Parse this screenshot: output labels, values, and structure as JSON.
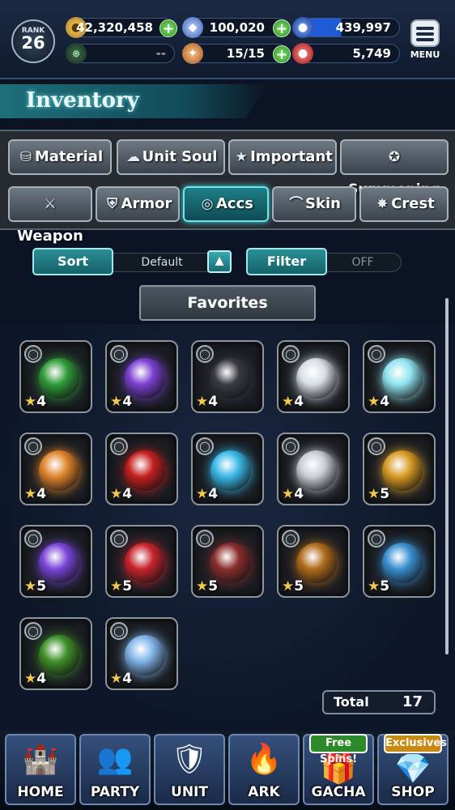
{
  "header": {
    "rank_label": "RANK",
    "rank_value": "26",
    "gold": "42,320,458",
    "crystals": "100,020",
    "blue_currency": "439,997",
    "guild_status": "--",
    "stamina": "15/15",
    "red_currency": "5,749",
    "menu_label": "MENU"
  },
  "title": "Inventory",
  "tabs_row1": [
    {
      "label": "Material",
      "icon": "sack-icon"
    },
    {
      "label": "Unit Soul",
      "icon": "soul-flame-icon"
    },
    {
      "label": "Important",
      "icon": "star-icon"
    },
    {
      "label": "Summoning",
      "icon": "summon-crest-icon"
    }
  ],
  "tabs_row2": [
    {
      "label": "Weapon",
      "icon": "sword-icon"
    },
    {
      "label": "Armor",
      "icon": "armor-icon"
    },
    {
      "label": "Accs",
      "icon": "necklace-icon"
    },
    {
      "label": "Skin",
      "icon": "hanger-icon"
    },
    {
      "label": "Crest",
      "icon": "crest-icon"
    }
  ],
  "active_tab": "Accs",
  "sort": {
    "label": "Sort",
    "value": "Default"
  },
  "filter": {
    "label": "Filter",
    "value": "OFF"
  },
  "favorites_label": "Favorites",
  "items": [
    {
      "rarity": "4",
      "color": "#2f9a3a"
    },
    {
      "rarity": "4",
      "color": "#7b3fd1"
    },
    {
      "rarity": "4",
      "color": "#3a3a46"
    },
    {
      "rarity": "4",
      "color": "#d8dde6"
    },
    {
      "rarity": "4",
      "color": "#8fe3ef"
    },
    {
      "rarity": "4",
      "color": "#e0842a"
    },
    {
      "rarity": "4",
      "color": "#c51f1f"
    },
    {
      "rarity": "4",
      "color": "#39b8e8"
    },
    {
      "rarity": "4",
      "color": "#c9cdd3"
    },
    {
      "rarity": "5",
      "color": "#d79a24"
    },
    {
      "rarity": "5",
      "color": "#7a45d8"
    },
    {
      "rarity": "5",
      "color": "#c8242c"
    },
    {
      "rarity": "5",
      "color": "#8a2d2d"
    },
    {
      "rarity": "5",
      "color": "#b06a1c"
    },
    {
      "rarity": "5",
      "color": "#3a8fd0"
    },
    {
      "rarity": "4",
      "color": "#3f8f2a"
    },
    {
      "rarity": "4",
      "color": "#7fb3e8"
    }
  ],
  "total": {
    "label": "Total",
    "value": "17"
  },
  "nav": [
    {
      "label": "HOME",
      "icon": "castle-icon",
      "badge": ""
    },
    {
      "label": "PARTY",
      "icon": "party-icon",
      "badge": ""
    },
    {
      "label": "UNIT",
      "icon": "unit-icon",
      "badge": ""
    },
    {
      "label": "ARK",
      "icon": "phoenix-icon",
      "badge": ""
    },
    {
      "label": "GACHA",
      "icon": "gacha-icon",
      "badge": "Free Spins!"
    },
    {
      "label": "SHOP",
      "icon": "shop-gem-icon",
      "badge": "Exclusives"
    }
  ],
  "colors": {
    "accent": "#1d7f86",
    "star": "#f2c94c",
    "plus": "#3fa83a"
  }
}
